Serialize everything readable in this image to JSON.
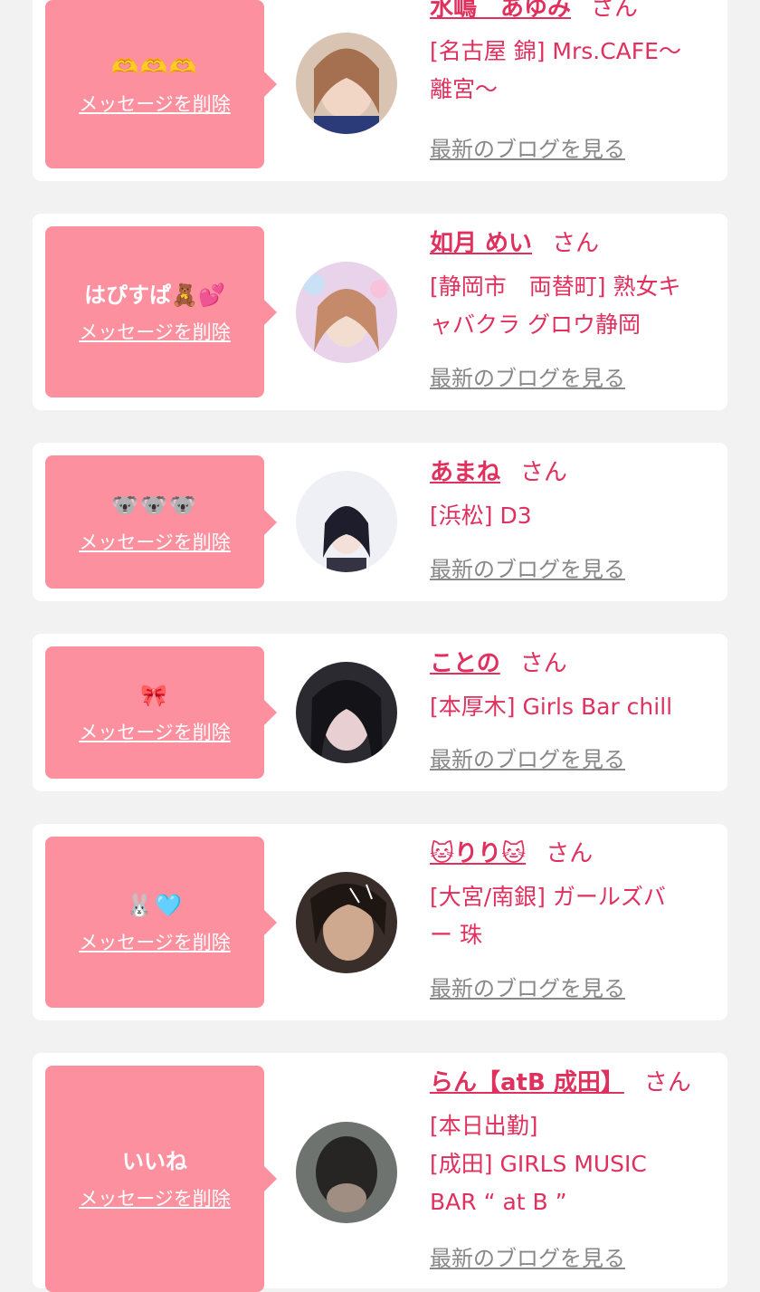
{
  "items": [
    {
      "message": "🫶🫶🫶",
      "delete_label": "メッセージを削除",
      "name": "水嶋　あゆみ",
      "honorific": "さん",
      "shop_lines": [
        "[名古屋 錦] Mrs.CAFE〜",
        "離宮〜"
      ],
      "blog_label": "最新のブログを見る",
      "avatar_colors": [
        "#d9c4b4",
        "#3b2a22"
      ]
    },
    {
      "message": "はぴすぱ🧸💕",
      "delete_label": "メッセージを削除",
      "name": "如月 めい",
      "honorific": "さん",
      "shop_lines": [
        "[静岡市　両替町] 熟女キ",
        "ャバクラ グロウ静岡"
      ],
      "blog_label": "最新のブログを見る",
      "avatar_colors": [
        "#e9d3ea",
        "#c48a6a"
      ]
    },
    {
      "message": "🐨🐨🐨",
      "delete_label": "メッセージを削除",
      "name": "あまね",
      "honorific": "さん",
      "shop_lines": [
        "[浜松] D3"
      ],
      "blog_label": "最新のブログを見る",
      "avatar_colors": [
        "#eef0f6",
        "#1d1d2b"
      ]
    },
    {
      "message": "🎀",
      "delete_label": "メッセージを削除",
      "name": "ことの",
      "honorific": "さん",
      "shop_lines": [
        "[本厚木] Girls Bar chill"
      ],
      "blog_label": "最新のブログを見る",
      "avatar_colors": [
        "#2a2a30",
        "#c9b2b6"
      ]
    },
    {
      "message": "🐰🩵",
      "delete_label": "メッセージを削除",
      "name": "🐱りり🐱",
      "honorific": "さん",
      "shop_lines": [
        "[大宮/南銀] ガールズバ",
        "ー 珠"
      ],
      "blog_label": "最新のブログを見る",
      "avatar_colors": [
        "#3a2e2a",
        "#cfa890"
      ]
    },
    {
      "message": "いいね",
      "delete_label": "メッセージを削除",
      "name": "らん【atB 成田】",
      "honorific": "さん",
      "shop_lines": [
        "[本日出勤]",
        "[成田] GIRLS MUSIC",
        "BAR “ at B ”"
      ],
      "blog_label": "最新のブログを見る",
      "avatar_colors": [
        "#6f7370",
        "#262524"
      ]
    }
  ]
}
